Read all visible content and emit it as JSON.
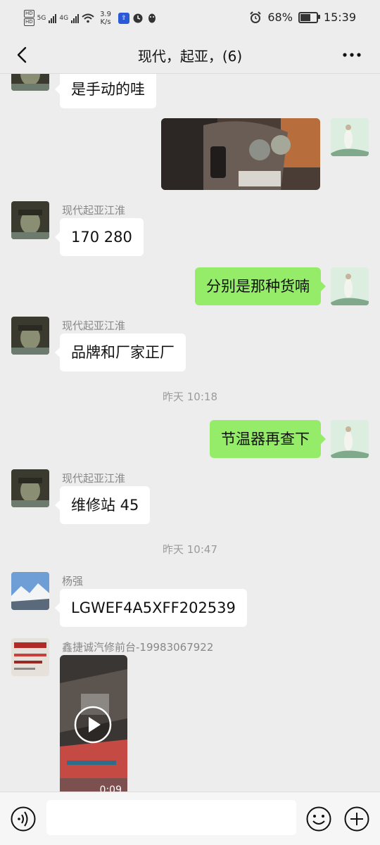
{
  "status_bar": {
    "net_speed_value": "3.9",
    "net_speed_unit": "K/s",
    "battery": "68%",
    "battery_level": 0.68,
    "time": "15:39",
    "network_5g": "5G",
    "network_4g": "4G"
  },
  "header": {
    "title": "现代，起亚，(6)"
  },
  "messages": [
    {
      "type": "text",
      "side": "left",
      "text": "是手动的哇"
    },
    {
      "type": "image",
      "side": "right"
    },
    {
      "type": "text",
      "side": "left",
      "sender": "现代起亚江淮",
      "text": "170 280"
    },
    {
      "type": "text",
      "side": "right",
      "text": "分别是那种货喃"
    },
    {
      "type": "text",
      "side": "left",
      "sender": "现代起亚江淮",
      "text": "品牌和厂家正厂"
    },
    {
      "type": "time",
      "text": "昨天 10:18"
    },
    {
      "type": "text",
      "side": "right",
      "text": "节温器再查下"
    },
    {
      "type": "text",
      "side": "left",
      "sender": "现代起亚江淮",
      "text": "维修站 45"
    },
    {
      "type": "time",
      "text": "昨天 10:47"
    },
    {
      "type": "text",
      "side": "left",
      "sender": "杨强",
      "text": "LGWEF4A5XFF202539"
    },
    {
      "type": "video",
      "side": "left",
      "sender": "鑫捷诚汽修前台-19983067922",
      "duration": "0:09"
    }
  ],
  "input_bar": {
    "placeholder": "",
    "icons": [
      "voice-icon",
      "emoji-icon",
      "plus-icon"
    ]
  }
}
